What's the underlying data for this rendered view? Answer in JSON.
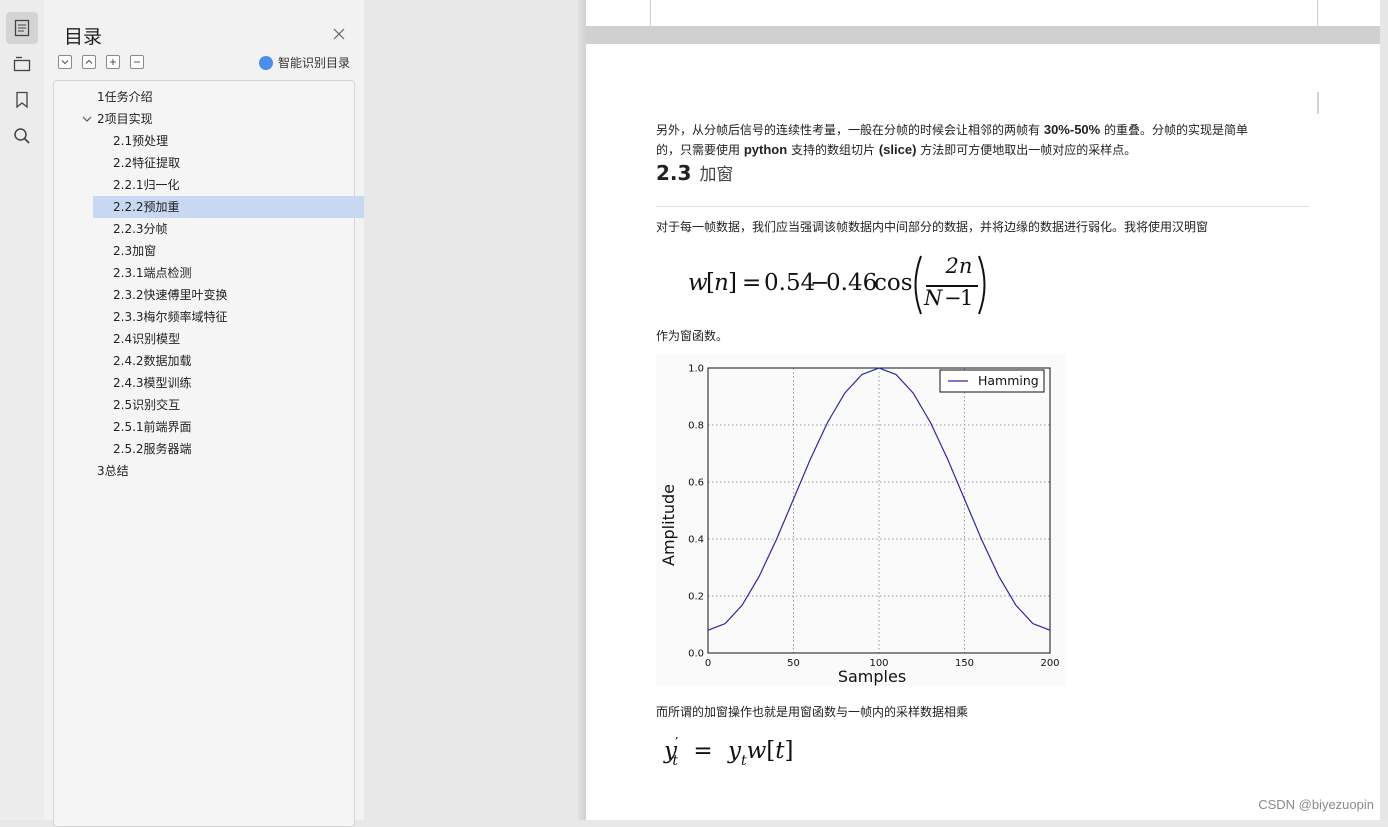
{
  "sidebar": {
    "title": "目录",
    "smart_label": "智能识别目录",
    "items": [
      {
        "label": "1任务介绍",
        "level": 1,
        "selected": false
      },
      {
        "label": "2项目实现",
        "level": 1,
        "selected": false,
        "expanded": true
      },
      {
        "label": "2.1预处理",
        "level": 2,
        "selected": false
      },
      {
        "label": "2.2特征提取",
        "level": 2,
        "selected": false
      },
      {
        "label": "2.2.1归一化",
        "level": 2,
        "selected": false
      },
      {
        "label": "2.2.2预加重",
        "level": 2,
        "selected": true
      },
      {
        "label": "2.2.3分帧",
        "level": 2,
        "selected": false
      },
      {
        "label": "2.3加窗",
        "level": 2,
        "selected": false
      },
      {
        "label": "2.3.1端点检测",
        "level": 2,
        "selected": false
      },
      {
        "label": "2.3.2快速傅里叶变换",
        "level": 2,
        "selected": false
      },
      {
        "label": "2.3.3梅尔频率域特征",
        "level": 2,
        "selected": false
      },
      {
        "label": "2.4识别模型",
        "level": 2,
        "selected": false
      },
      {
        "label": "2.4.2数据加载",
        "level": 2,
        "selected": false
      },
      {
        "label": "2.4.3模型训练",
        "level": 2,
        "selected": false
      },
      {
        "label": "2.5识别交互",
        "level": 2,
        "selected": false
      },
      {
        "label": "2.5.1前端界面",
        "level": 2,
        "selected": false
      },
      {
        "label": "2.5.2服务器端",
        "level": 2,
        "selected": false
      },
      {
        "label": "3总结",
        "level": 1,
        "selected": false
      }
    ]
  },
  "document": {
    "para1": {
      "a": "另外，从分帧后信号的连续性考量，一般在分帧的时候会让相邻的两帧有",
      "b": "30%-50%",
      "c": "的重叠。分帧的实现是简单",
      "d": "的，只需要使用",
      "e": "python",
      "f": "支持的数组切片",
      "g": "(slice)",
      "h": "方法即可方便地取出一帧对应的采样点。"
    },
    "heading_num": "2.3",
    "heading_text": "加窗",
    "para2": "对于每一帧数据，我们应当强调该帧数据内中间部分的数据，并将边缘的数据进行弱化。我将使用汉明窗",
    "eq1": {
      "lhs_var": "w",
      "lhs_idx": "n",
      "const_a": "0.54",
      "const_b": "0.46",
      "fn": "cos",
      "num": "2n",
      "den_var": "N",
      "den_rest": "1"
    },
    "para3": "作为窗函数。",
    "para4": "而所谓的加窗操作也就是用窗函数与一帧内的采样数据相乘",
    "eq2": {
      "y": "y",
      "prime": "′",
      "sub": "t",
      "w": "w",
      "arg": "t"
    }
  },
  "chart_data": {
    "type": "line",
    "xlabel": "Samples",
    "ylabel": "Amplitude",
    "xlim": [
      0,
      200
    ],
    "ylim": [
      0.0,
      1.0
    ],
    "xticks": [
      "0",
      "50",
      "100",
      "150",
      "200"
    ],
    "yticks": [
      "0.0",
      "0.2",
      "0.4",
      "0.6",
      "0.8",
      "1.0"
    ],
    "grid": true,
    "legend_position": "top-right",
    "series": [
      {
        "name": "Hamming",
        "color": "#2a2aa6",
        "x": [
          0,
          10,
          20,
          30,
          40,
          50,
          60,
          70,
          80,
          90,
          100,
          110,
          120,
          130,
          140,
          150,
          160,
          170,
          180,
          190,
          200
        ],
        "y": [
          0.08,
          0.103,
          0.168,
          0.27,
          0.398,
          0.54,
          0.682,
          0.81,
          0.912,
          0.977,
          1.0,
          0.977,
          0.912,
          0.81,
          0.682,
          0.54,
          0.398,
          0.27,
          0.168,
          0.103,
          0.08
        ]
      }
    ]
  },
  "watermark": "CSDN @biyezuopin"
}
